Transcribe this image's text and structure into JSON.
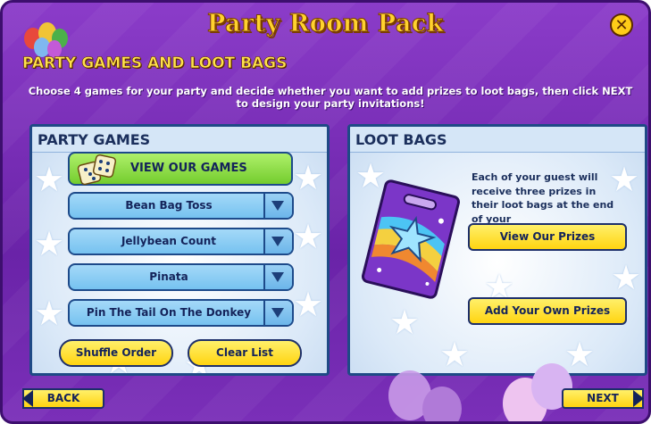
{
  "header": {
    "title": "Party Room Pack",
    "subtitle": "PARTY GAMES AND LOOT BAGS"
  },
  "instructions": "Choose 4 games for your party and decide whether you want to add prizes to loot bags, then click NEXT to design your party invitations!",
  "party_games": {
    "heading": "PARTY GAMES",
    "view_games_label": "VIEW OUR GAMES",
    "slots": [
      "Bean Bag Toss",
      "Jellybean Count",
      "Pinata",
      "Pin The Tail On The Donkey"
    ],
    "shuffle_label": "Shuffle Order",
    "clear_label": "Clear List"
  },
  "loot_bags": {
    "heading": "LOOT BAGS",
    "description": "Each of your guest will receive three prizes in their loot bags at the end of your",
    "view_prizes_label": "View Our Prizes",
    "add_prizes_label": "Add Your Own Prizes"
  },
  "footer": {
    "back_label": "BACK",
    "next_label": "NEXT"
  },
  "colors": {
    "frame": "#7a2fb8",
    "title": "#ffd22e",
    "button_yellow": "#ffd411",
    "select_blue": "#76c2f0",
    "view_games_green": "#74cc2e",
    "panel_border": "#1f4a86"
  },
  "icons": [
    "balloons-icon",
    "close-icon",
    "dice-icon",
    "dropdown-arrow-icon",
    "loot-bag-icon",
    "back-arrow-icon",
    "next-arrow-icon"
  ]
}
